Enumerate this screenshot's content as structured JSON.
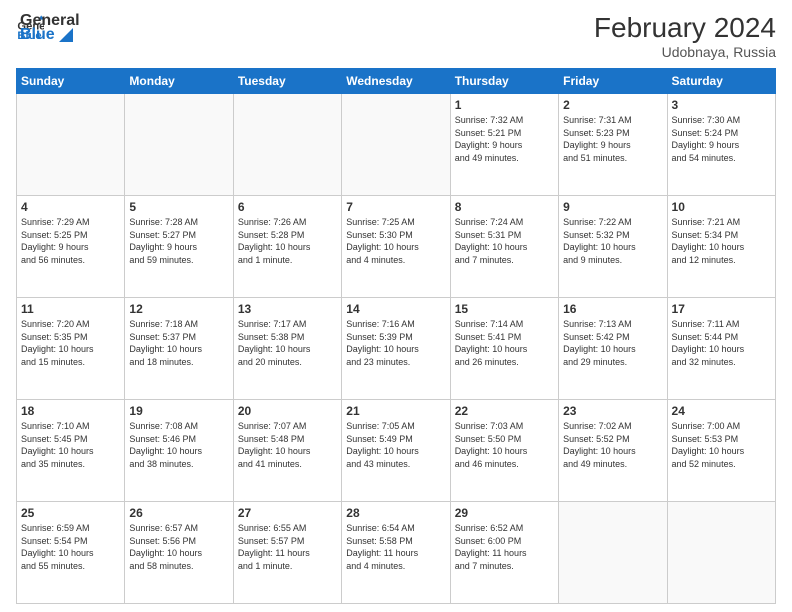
{
  "header": {
    "logo_line1": "General",
    "logo_line2": "Blue",
    "month_title": "February 2024",
    "location": "Udobnaya, Russia"
  },
  "weekdays": [
    "Sunday",
    "Monday",
    "Tuesday",
    "Wednesday",
    "Thursday",
    "Friday",
    "Saturday"
  ],
  "weeks": [
    [
      {
        "day": "",
        "info": ""
      },
      {
        "day": "",
        "info": ""
      },
      {
        "day": "",
        "info": ""
      },
      {
        "day": "",
        "info": ""
      },
      {
        "day": "1",
        "info": "Sunrise: 7:32 AM\nSunset: 5:21 PM\nDaylight: 9 hours\nand 49 minutes."
      },
      {
        "day": "2",
        "info": "Sunrise: 7:31 AM\nSunset: 5:23 PM\nDaylight: 9 hours\nand 51 minutes."
      },
      {
        "day": "3",
        "info": "Sunrise: 7:30 AM\nSunset: 5:24 PM\nDaylight: 9 hours\nand 54 minutes."
      }
    ],
    [
      {
        "day": "4",
        "info": "Sunrise: 7:29 AM\nSunset: 5:25 PM\nDaylight: 9 hours\nand 56 minutes."
      },
      {
        "day": "5",
        "info": "Sunrise: 7:28 AM\nSunset: 5:27 PM\nDaylight: 9 hours\nand 59 minutes."
      },
      {
        "day": "6",
        "info": "Sunrise: 7:26 AM\nSunset: 5:28 PM\nDaylight: 10 hours\nand 1 minute."
      },
      {
        "day": "7",
        "info": "Sunrise: 7:25 AM\nSunset: 5:30 PM\nDaylight: 10 hours\nand 4 minutes."
      },
      {
        "day": "8",
        "info": "Sunrise: 7:24 AM\nSunset: 5:31 PM\nDaylight: 10 hours\nand 7 minutes."
      },
      {
        "day": "9",
        "info": "Sunrise: 7:22 AM\nSunset: 5:32 PM\nDaylight: 10 hours\nand 9 minutes."
      },
      {
        "day": "10",
        "info": "Sunrise: 7:21 AM\nSunset: 5:34 PM\nDaylight: 10 hours\nand 12 minutes."
      }
    ],
    [
      {
        "day": "11",
        "info": "Sunrise: 7:20 AM\nSunset: 5:35 PM\nDaylight: 10 hours\nand 15 minutes."
      },
      {
        "day": "12",
        "info": "Sunrise: 7:18 AM\nSunset: 5:37 PM\nDaylight: 10 hours\nand 18 minutes."
      },
      {
        "day": "13",
        "info": "Sunrise: 7:17 AM\nSunset: 5:38 PM\nDaylight: 10 hours\nand 20 minutes."
      },
      {
        "day": "14",
        "info": "Sunrise: 7:16 AM\nSunset: 5:39 PM\nDaylight: 10 hours\nand 23 minutes."
      },
      {
        "day": "15",
        "info": "Sunrise: 7:14 AM\nSunset: 5:41 PM\nDaylight: 10 hours\nand 26 minutes."
      },
      {
        "day": "16",
        "info": "Sunrise: 7:13 AM\nSunset: 5:42 PM\nDaylight: 10 hours\nand 29 minutes."
      },
      {
        "day": "17",
        "info": "Sunrise: 7:11 AM\nSunset: 5:44 PM\nDaylight: 10 hours\nand 32 minutes."
      }
    ],
    [
      {
        "day": "18",
        "info": "Sunrise: 7:10 AM\nSunset: 5:45 PM\nDaylight: 10 hours\nand 35 minutes."
      },
      {
        "day": "19",
        "info": "Sunrise: 7:08 AM\nSunset: 5:46 PM\nDaylight: 10 hours\nand 38 minutes."
      },
      {
        "day": "20",
        "info": "Sunrise: 7:07 AM\nSunset: 5:48 PM\nDaylight: 10 hours\nand 41 minutes."
      },
      {
        "day": "21",
        "info": "Sunrise: 7:05 AM\nSunset: 5:49 PM\nDaylight: 10 hours\nand 43 minutes."
      },
      {
        "day": "22",
        "info": "Sunrise: 7:03 AM\nSunset: 5:50 PM\nDaylight: 10 hours\nand 46 minutes."
      },
      {
        "day": "23",
        "info": "Sunrise: 7:02 AM\nSunset: 5:52 PM\nDaylight: 10 hours\nand 49 minutes."
      },
      {
        "day": "24",
        "info": "Sunrise: 7:00 AM\nSunset: 5:53 PM\nDaylight: 10 hours\nand 52 minutes."
      }
    ],
    [
      {
        "day": "25",
        "info": "Sunrise: 6:59 AM\nSunset: 5:54 PM\nDaylight: 10 hours\nand 55 minutes."
      },
      {
        "day": "26",
        "info": "Sunrise: 6:57 AM\nSunset: 5:56 PM\nDaylight: 10 hours\nand 58 minutes."
      },
      {
        "day": "27",
        "info": "Sunrise: 6:55 AM\nSunset: 5:57 PM\nDaylight: 11 hours\nand 1 minute."
      },
      {
        "day": "28",
        "info": "Sunrise: 6:54 AM\nSunset: 5:58 PM\nDaylight: 11 hours\nand 4 minutes."
      },
      {
        "day": "29",
        "info": "Sunrise: 6:52 AM\nSunset: 6:00 PM\nDaylight: 11 hours\nand 7 minutes."
      },
      {
        "day": "",
        "info": ""
      },
      {
        "day": "",
        "info": ""
      }
    ]
  ]
}
